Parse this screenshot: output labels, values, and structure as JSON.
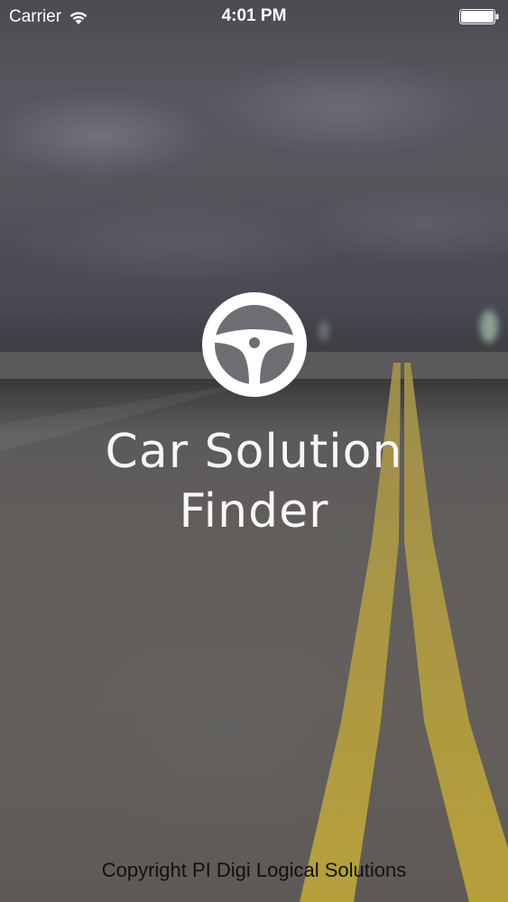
{
  "status_bar": {
    "carrier": "Carrier",
    "time": "4:01 PM",
    "wifi_icon": "wifi-icon",
    "battery_icon": "battery-icon"
  },
  "splash": {
    "logo_icon": "steering-wheel-icon",
    "title_line1": "Car Solution",
    "title_line2": "Finder",
    "copyright": "Copyright PI Digi Logical Solutions"
  },
  "colors": {
    "title_text": "#ffffff",
    "copyright_text": "#111111",
    "road_line": "#d6b83a"
  }
}
